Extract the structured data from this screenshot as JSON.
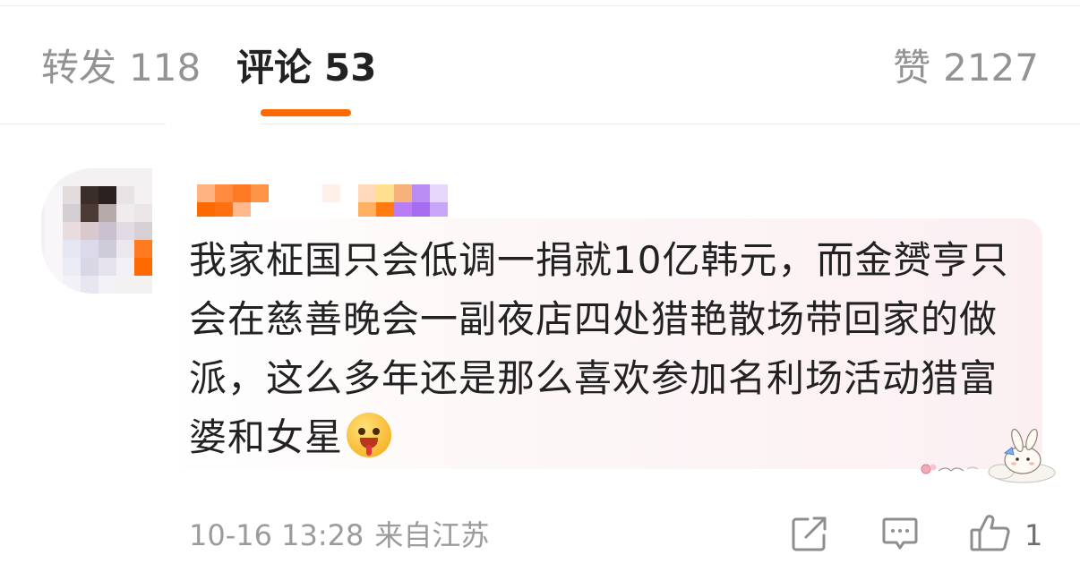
{
  "tabs": {
    "repost": {
      "label": "转发",
      "count": "118"
    },
    "comments": {
      "label": "评论",
      "count": "53"
    },
    "likes": {
      "label": "赞",
      "count": "2127"
    }
  },
  "comment": {
    "author_avatar": "pixelated-avatar",
    "author_name": "pixelated-username",
    "text": "我家柾国只会低调一捐就10亿韩元，而金赟亨只会在慈善晚会一副夜店四处猎艳散场带回家的做派，这么多年还是那么喜欢参加名利场活动猎富婆和女星",
    "emoji": "drooling-face-emoji",
    "badge": "bunny-cloud-sticker",
    "time": "10-16 13:28",
    "location": "来自江苏",
    "like_count": "1"
  },
  "colors": {
    "accent": "#ff6a00",
    "text": "#222222",
    "muted": "#9b9b9b",
    "bubble": "#fbeff2"
  }
}
